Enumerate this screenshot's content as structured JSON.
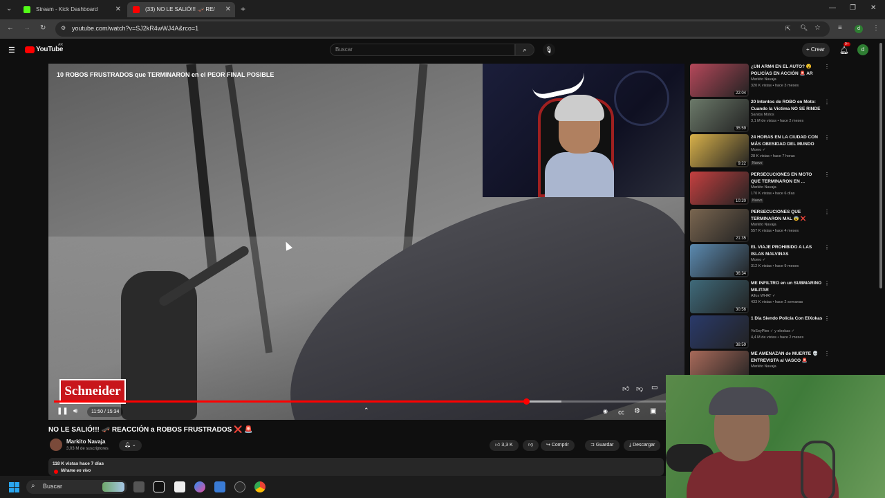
{
  "browser": {
    "tabs": [
      {
        "title": "Stream - Kick Dashboard",
        "favicon_color": "#53fc18"
      },
      {
        "title": "(33) NO LE SALIÓ!!! 🛹 RE/",
        "favicon_color": "#ff0000"
      }
    ],
    "new_tab": "+",
    "url": "youtube.com/watch?v=SJ2kR4wWJ4A&rco=1",
    "window_controls": [
      "—",
      "❐",
      "✕"
    ]
  },
  "youtube": {
    "logo_text": "YouTube",
    "country": "AR",
    "search_placeholder": "Buscar",
    "create_label": "Crear",
    "notif_count": "9+",
    "user_initial": "d"
  },
  "video": {
    "overlay_title": "10 ROBOS FRUSTRADOS que TERMINARON en el PEOR FINAL POSIBLE",
    "sponsor": "Schneider",
    "time": "11:50 / 15:34",
    "progress": 0.756,
    "buffered": 0.812,
    "title": "NO LE SALIÓ!!! 🛹 REACCIÓN a ROBOS FRUSTRADOS ❌ 🚨",
    "channel": "Markito Navaja",
    "subscribers": "3,03 M de suscriptores",
    "likes": "3,3 K",
    "share_label": "Comprir",
    "save_label": "Guardar",
    "download_label": "Descargar",
    "views_date": "118 K vistas  hace 7 días",
    "live_link": "Mírame en vivo",
    "accent": "#ff0000"
  },
  "recommendations": [
    {
      "title": "¿UN ARM4 EN EL AUTO? 😮 POLICÍAS EN ACCIÓN 🚨 AR",
      "channel": "Markito Navaja",
      "meta": "320 K vistas • hace 3 meses",
      "duration": "22:04",
      "new": "",
      "color": "#b5485a"
    },
    {
      "title": "20 Intentos de ROBO en Moto: Cuando la Víctima NO SE RINDE",
      "channel": "Santos Motos",
      "meta": "3,1 M de vistas • hace 2 meses",
      "duration": "35:59",
      "new": "",
      "color": "#6c7a6a"
    },
    {
      "title": "24 HORAS EN LA CIUDAD CON MÁS OBESIDAD DEL MUNDO",
      "channel": "Momo ✓",
      "meta": "28 K vistas • hace 7 horas",
      "duration": "9:22",
      "new": "Nuevo",
      "color": "#d8b14a"
    },
    {
      "title": "PERSECUCIONES EN MOTO QUE TERMINARON EN ...",
      "channel": "Markito Navaja",
      "meta": "170 K vistas • hace 6 días",
      "duration": "10:20",
      "new": "Nuevo",
      "color": "#c54040"
    },
    {
      "title": "PERSECUCIONES QUE TERMINARON MAL 😨 ❌",
      "channel": "Markito Navaja",
      "meta": "557 K vistas • hace 4 meses",
      "duration": "21:35",
      "new": "",
      "color": "#7a6650"
    },
    {
      "title": "EL VIAJE PROHIBIDO A LAS ISLAS MALVINAS",
      "channel": "Momo ✓",
      "meta": "312 K vistas • hace 9 meses",
      "duration": "36:34",
      "new": "",
      "color": "#5b8ab0"
    },
    {
      "title": "ME INFILTRO en un SUBMARINO MILITAR",
      "channel": "Alfox WHAT ✓",
      "meta": "433 K vistas • hace 2 semanas",
      "duration": "30:56",
      "new": "",
      "color": "#3f6a7a"
    },
    {
      "title": "1 Día Siendo Policía Con ElXokas",
      "channel": "YoSoyPlex ✓ y elxokas ✓",
      "meta": "4,4 M de vistas • hace 2 meses",
      "duration": "38:59",
      "new": "",
      "color": "#2a3a6a"
    },
    {
      "title": "ME AMENAZAN de MUERTE 💀 ENTREVISTA al VASCO 🚨",
      "channel": "Markito Navaja",
      "meta": "",
      "duration": "",
      "new": "",
      "color": "#a86a5a"
    }
  ],
  "taskbar": {
    "search_label": "Buscar"
  }
}
